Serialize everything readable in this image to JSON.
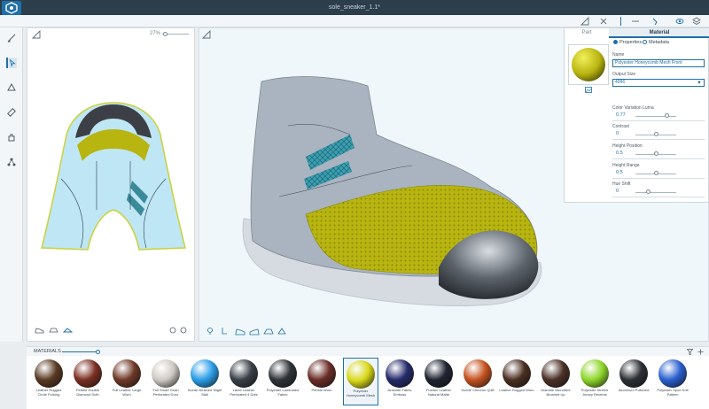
{
  "window": {
    "title": "sole_sneaker_1.1*"
  },
  "panel2d": {
    "zoom": "27%"
  },
  "properties": {
    "tabs": {
      "part": "Part",
      "material": "Material"
    },
    "radio": {
      "properties": "Properties",
      "metadata": "Metadata",
      "selected": "properties"
    },
    "name_label": "Name",
    "name_value": "Polyester Honeycomb Mesh Front",
    "output_size_label": "Output Size",
    "output_size_value": "4096",
    "sliders": [
      {
        "label": "Color Variation Luma",
        "value": "0.77",
        "fraction": 0.77
      },
      {
        "label": "Contrast",
        "value": "0",
        "fraction": 0.5
      },
      {
        "label": "Height Position",
        "value": "0.5",
        "fraction": 0.5
      },
      {
        "label": "Height Range",
        "value": "0.5",
        "fraction": 0.5
      },
      {
        "label": "Hue Shift",
        "value": "0",
        "fraction": 0.3
      }
    ]
  },
  "materials": {
    "title": "MATERIALS",
    "selected_index": 8,
    "items": [
      {
        "name": "Leather Rugged Circle Forking",
        "color": "#5a3a22"
      },
      {
        "name": "Pebble Double Diamond Suth",
        "color": "#7a2f22"
      },
      {
        "name": "Full Leather Large Worn",
        "color": "#6e3826"
      },
      {
        "name": "Full Smart Grain Perforated Duro",
        "color": "#cfcac3"
      },
      {
        "name": "Suede Brushed Slight Stall",
        "color": "#2a9ee8"
      },
      {
        "name": "Lamb Leather Perforated 4 Dots",
        "color": "#3a4048"
      },
      {
        "name": "Polyester Laminated Fabric",
        "color": "#2f3338"
      },
      {
        "name": "Pebble Worn",
        "color": "#6a2d26"
      },
      {
        "name": "Polyester Honeycomb Mesh",
        "color": "#d8d818"
      },
      {
        "name": "Aramide Fabric Emboss",
        "color": "#242a6a"
      },
      {
        "name": "Fuelton Leather Natural Matte",
        "color": "#1f2330"
      },
      {
        "name": "Suede Chevron Quilt",
        "color": "#c4521e"
      },
      {
        "name": "Leather Rugged Worn",
        "color": "#4a2e22"
      },
      {
        "name": "Aramide Microfibre Brushed Up",
        "color": "#4a3026"
      },
      {
        "name": "Polyester Stretch Jersey Reverse",
        "color": "#8ed62a"
      },
      {
        "name": "Aluminum Polished",
        "color": "#2c3034"
      },
      {
        "name": "Polyester Sport Knit Pattern",
        "color": "#2a5fd0"
      }
    ]
  },
  "icons": {
    "top_right": [
      "ruler-icon",
      "pin-icon",
      "eye-icon",
      "layers-icon"
    ],
    "left": [
      "brush-icon",
      "select-arrow-icon",
      "lasso-icon",
      "measure-icon",
      "hand-icon",
      "tree-icon"
    ]
  }
}
